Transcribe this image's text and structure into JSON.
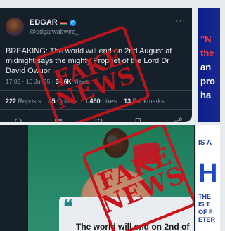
{
  "tweet": {
    "display_name": "EDGAR",
    "handle": "@edgarwabwire_",
    "more": "···",
    "text": "BREAKING: The world will end on 2nd August at midnight says the mighty Prophet of the Lord Dr David Owuor",
    "time": "17:05 · 10 Jul 25 · ",
    "views_count": "34.6K",
    "views_label": " Views",
    "reposts_count": "222",
    "reposts_label": " Reposts",
    "quotes_count": "45",
    "quotes_label": " Quotes",
    "likes_count": "1,450",
    "likes_label": " Likes",
    "bookmarks_count": "13",
    "bookmarks_label": " Bookmarks"
  },
  "stamp": {
    "line1": "FAKE",
    "line2": "NEWS"
  },
  "right_top": {
    "l1": "\"N",
    "l2": "the",
    "l3": "an",
    "l4": "pro",
    "l5": "ha"
  },
  "post2": {
    "quote_mark": "❝",
    "quote_text": "The world will end on 2nd of"
  },
  "right_bottom": {
    "l1": "IS A",
    "l2": "H",
    "l3": "THE",
    "l4": "IS T",
    "l5": "OF F",
    "l6": "ETER"
  },
  "icons": [
    "reply-icon",
    "repost-icon",
    "like-icon",
    "bookmark-icon",
    "share-icon",
    "verified-icon"
  ],
  "colors": {
    "stamp_red": "#c9141b",
    "x_dark": "#15202b",
    "x_blue": "#1d9bf0"
  }
}
